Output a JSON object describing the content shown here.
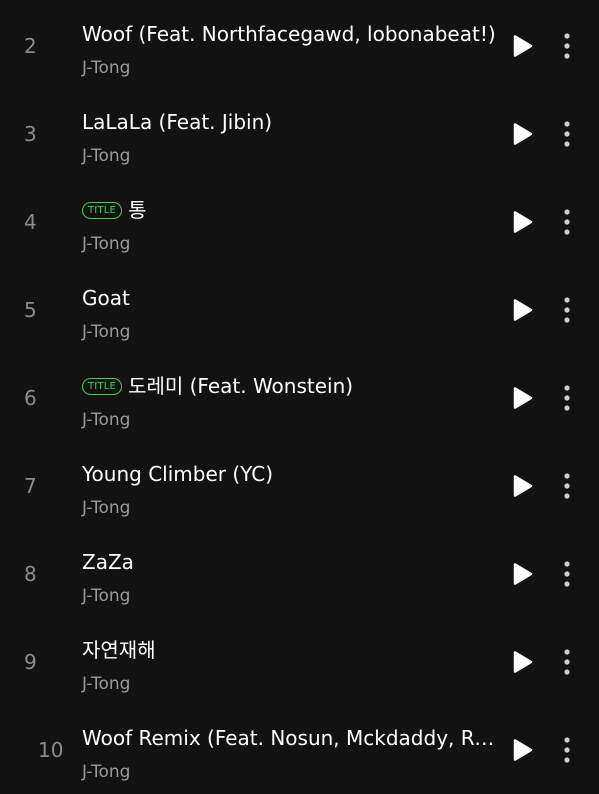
{
  "badge_label": "TITLE",
  "colors": {
    "background": "#121212",
    "primary_text": "#ffffff",
    "secondary_text": "#9a9a9a",
    "track_number": "#8c8c8c",
    "title_badge": "#3fd154"
  },
  "icons": {
    "play": "play-icon",
    "more": "more-vertical-icon"
  },
  "tracks": [
    {
      "number": "2",
      "title": "Woof (Feat. Northfacegawd, lobonabeat!)",
      "artist": "J-Tong",
      "is_title_track": false
    },
    {
      "number": "3",
      "title": "LaLaLa (Feat. Jibin)",
      "artist": "J-Tong",
      "is_title_track": false
    },
    {
      "number": "4",
      "title": "통",
      "artist": "J-Tong",
      "is_title_track": true
    },
    {
      "number": "5",
      "title": "Goat",
      "artist": "J-Tong",
      "is_title_track": false
    },
    {
      "number": "6",
      "title": "도레미 (Feat. Wonstein)",
      "artist": "J-Tong",
      "is_title_track": true
    },
    {
      "number": "7",
      "title": "Young Climber (YC)",
      "artist": "J-Tong",
      "is_title_track": false
    },
    {
      "number": "8",
      "title": "ZaZa",
      "artist": "J-Tong",
      "is_title_track": false
    },
    {
      "number": "9",
      "title": "자연재해",
      "artist": "J-Tong",
      "is_title_track": false
    },
    {
      "number": "10",
      "title": "Woof Remix (Feat. Nosun, Mckdaddy, Raf…",
      "artist": "J-Tong",
      "is_title_track": false
    }
  ]
}
